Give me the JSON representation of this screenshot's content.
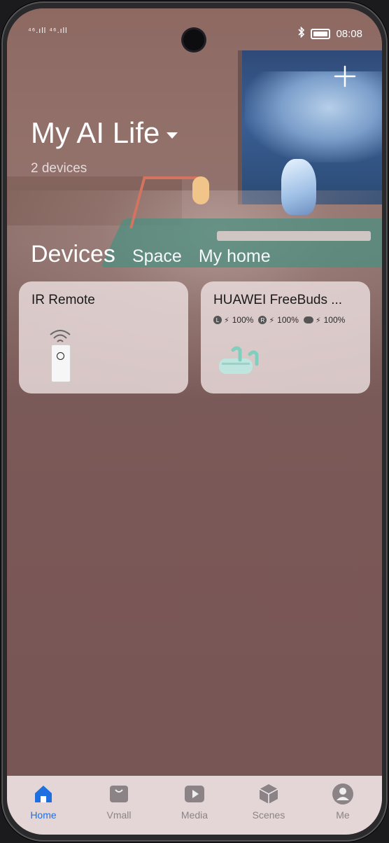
{
  "status_bar": {
    "network": "⁴⁶.ıll ⁴⁶.ıll",
    "time": "08:08"
  },
  "header": {
    "title": "My AI Life",
    "subtitle": "2 devices"
  },
  "tabs": [
    {
      "label": "Devices"
    },
    {
      "label": "Space"
    },
    {
      "label": "My home"
    }
  ],
  "devices": [
    {
      "name": "IR Remote"
    },
    {
      "name": "HUAWEI FreeBuds ...",
      "battery": {
        "left_label": "L",
        "left": "100%",
        "right_label": "R",
        "right": "100%",
        "case": "100%"
      }
    }
  ],
  "nav": [
    {
      "label": "Home",
      "icon": "home-icon",
      "active": true
    },
    {
      "label": "Vmall",
      "icon": "shopping-bag-icon"
    },
    {
      "label": "Media",
      "icon": "play-icon"
    },
    {
      "label": "Scenes",
      "icon": "cube-icon"
    },
    {
      "label": "Me",
      "icon": "avatar-icon"
    }
  ],
  "colors": {
    "accent": "#1f6fe0",
    "background": "#7a5857",
    "card": "#ecdede"
  }
}
